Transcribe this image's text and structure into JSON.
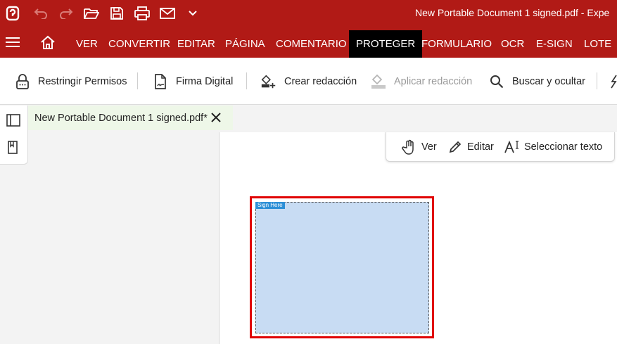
{
  "titlebar": {
    "document_title": "New Portable Document 1 signed.pdf   -   Expe",
    "quick_access": [
      "app-logo-icon",
      "undo-icon",
      "redo-icon",
      "open-folder-icon",
      "save-icon",
      "print-icon",
      "email-icon",
      "chevron-down-icon"
    ]
  },
  "ribbon": {
    "tabs": [
      "VER",
      "CONVERTIR",
      "EDITAR",
      "PÁGINA",
      "COMENTARIO",
      "PROTEGER",
      "FORMULARIO",
      "OCR",
      "E-SIGN",
      "LOTE"
    ],
    "active_tab": "PROTEGER"
  },
  "toolbar": {
    "restrict_permissions": "Restringir Permisos",
    "digital_signature": "Firma Digital",
    "create_redaction": "Crear redacción",
    "apply_redaction": "Aplicar redacción",
    "search_hide": "Buscar y ocultar"
  },
  "document_tab": {
    "label": "New Portable Document 1 signed.pdf*"
  },
  "modes": {
    "view": "Ver",
    "edit": "Editar",
    "select_text": "Seleccionar texto"
  },
  "signature_field": {
    "tag": "Sign Here"
  },
  "colors": {
    "brand": "#b11a16",
    "active_tab": "#000000",
    "signature_fill": "#c8dcf3",
    "signature_border": "#e00000"
  }
}
